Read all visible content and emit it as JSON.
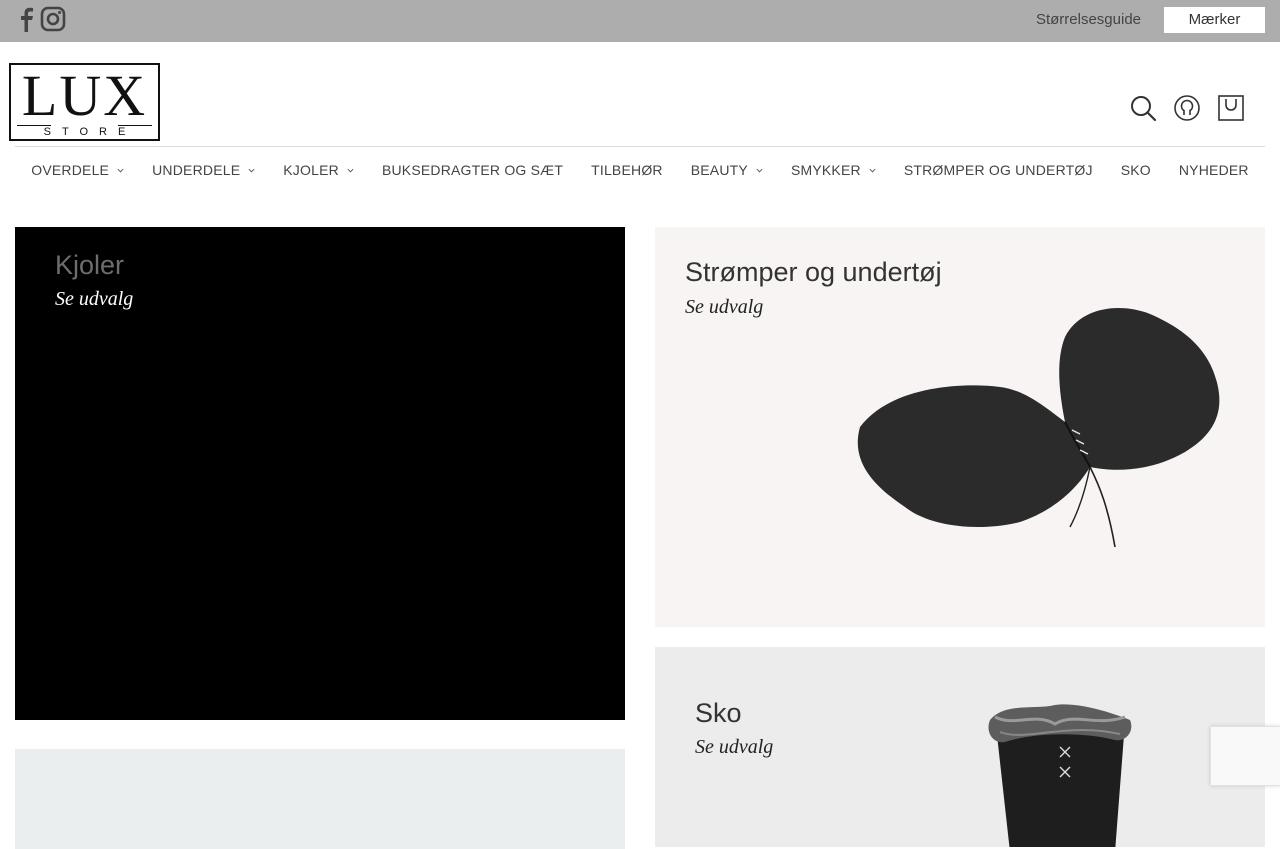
{
  "topbar": {
    "social": [
      "facebook-icon",
      "instagram-icon"
    ],
    "size_guide": "Størrelsesguide",
    "brands": "Mærker"
  },
  "logo": {
    "main": "LUX",
    "sub": "STORE"
  },
  "header_icons": [
    "search-icon",
    "account-icon",
    "cart-icon"
  ],
  "nav": {
    "items": [
      {
        "label": "OVERDELE",
        "dropdown": true
      },
      {
        "label": "UNDERDELE",
        "dropdown": true
      },
      {
        "label": "KJOLER",
        "dropdown": true
      },
      {
        "label": "BUKSEDRAGTER OG SÆT",
        "dropdown": false
      },
      {
        "label": "TILBEHØR",
        "dropdown": false
      },
      {
        "label": "BEAUTY",
        "dropdown": true
      },
      {
        "label": "SMYKKER",
        "dropdown": true
      },
      {
        "label": "STRØMPER OG UNDERTØJ",
        "dropdown": false
      },
      {
        "label": "SKO",
        "dropdown": false
      },
      {
        "label": "NYHEDER",
        "dropdown": false
      }
    ]
  },
  "tiles": {
    "dresses": {
      "title": "Kjoler",
      "cta": "Se udvalg"
    },
    "underwear": {
      "title": "Strømper og undertøj",
      "cta": "Se udvalg"
    },
    "shoes": {
      "title": "Sko",
      "cta": "Se udvalg"
    }
  },
  "colors": {
    "topbar": "#adadad",
    "underwear_bg": "#f7f4f3",
    "shoes_bg": "#ececec"
  }
}
